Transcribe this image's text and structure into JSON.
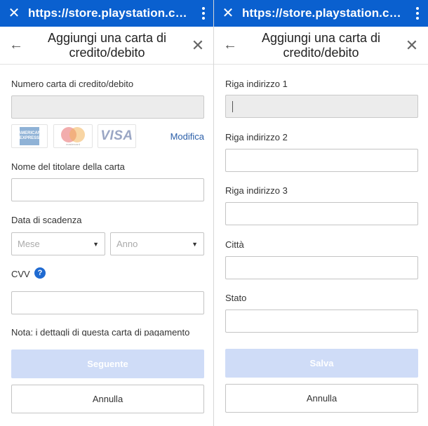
{
  "left": {
    "browser": {
      "close_icon": "✕",
      "url": "https://store.playstation.com/it-it/home",
      "menu_icon": "more-vert-icon"
    },
    "header": {
      "title_line1": "Aggiungi una carta di",
      "title_line2": "credito/debito"
    },
    "card_number": {
      "label": "Numero carta di credito/debito",
      "value": ""
    },
    "card_logos": {
      "amex_text": "AMERICAN EXPRESS",
      "mastercard_text": "mastercard",
      "visa_text": "VISA"
    },
    "modify_link": "Modifica",
    "holder_name": {
      "label": "Nome del titolare della carta",
      "value": ""
    },
    "expiry": {
      "label": "Data di scadenza",
      "month_placeholder": "Mese",
      "year_placeholder": "Anno"
    },
    "cvv": {
      "label": "CVV",
      "help_icon": "?",
      "value": ""
    },
    "note": "Nota: i dettagli di questa carta di pagamento",
    "next_button": "Seguente",
    "cancel_button": "Annulla"
  },
  "right": {
    "browser": {
      "close_icon": "✕",
      "url": "https://store.playstation.com/it-it/home",
      "menu_icon": "more-vert-icon"
    },
    "header": {
      "title_line1": "Aggiungi una carta di",
      "title_line2": "credito/debito"
    },
    "address1": {
      "label": "Riga indirizzo 1",
      "value": ""
    },
    "address2": {
      "label": "Riga indirizzo 2",
      "value": ""
    },
    "address3": {
      "label": "Riga indirizzo 3",
      "value": ""
    },
    "city": {
      "label": "Città",
      "value": ""
    },
    "state": {
      "label": "Stato",
      "value": ""
    },
    "save_button": "Salva",
    "cancel_button": "Annulla"
  },
  "colors": {
    "browser_bar": "#0a60cf",
    "primary_disabled": "#cfdcf7",
    "link": "#2a5ea8",
    "help": "#1f6ad1"
  }
}
